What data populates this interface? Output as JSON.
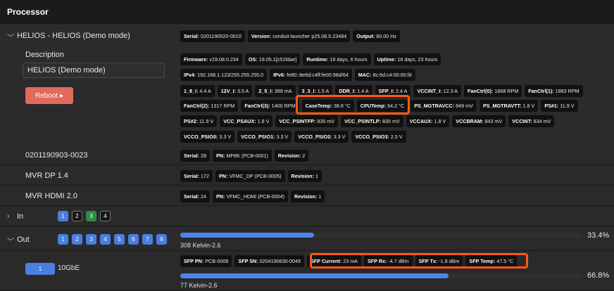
{
  "header": {
    "title": "Processor"
  },
  "helios": {
    "title": "HELIOS - HELIOS (Demo mode)",
    "chips": [
      {
        "k": "Serial:",
        "v": "0201190520-0010"
      },
      {
        "k": "Version:",
        "v": "conduit-launcher p25.08.0.23484"
      },
      {
        "k": "Output:",
        "v": "60.00 Hz"
      }
    ],
    "description_label": "Description",
    "description_value": "HELIOS (Demo mode)",
    "reboot_label": "Reboot ▸",
    "lines": [
      [
        {
          "k": "Firmware:",
          "v": "v19.08.0.234"
        },
        {
          "k": "OS:",
          "v": "19.05.1[c51fdae]"
        },
        {
          "k": "Runtime:",
          "v": "19 days, 6 hours"
        },
        {
          "k": "Uptime:",
          "v": "16 days, 23 hours"
        }
      ],
      [
        {
          "k": "IPv4:",
          "v": "192.168.1.123/255.255.255.0"
        },
        {
          "k": "IPv6:",
          "v": "fe80::8e6d:c4ff:fe00:98d/64"
        },
        {
          "k": "MAC:",
          "v": "8c:6d:c4:00:00:fd"
        }
      ],
      [
        {
          "k": "1_8_I:",
          "v": "4.4 A"
        },
        {
          "k": "12V_I:",
          "v": "3.5 A"
        },
        {
          "k": "2_5_I:",
          "v": "389 mA"
        },
        {
          "k": "3_3_I:",
          "v": "1.5 A"
        },
        {
          "k": "DDR_I:",
          "v": "1.4 A"
        },
        {
          "k": "SFP_I:",
          "v": "2.4 A"
        },
        {
          "k": "VCCINT_I:",
          "v": "12.3 A"
        },
        {
          "k": "FanCtrl(0):",
          "v": "1868 RPM"
        },
        {
          "k": "FanCtrl(1):",
          "v": "1883 RPM"
        }
      ],
      [
        {
          "k": "FanCtrl(2):",
          "v": "1317 RPM"
        },
        {
          "k": "FanCtrl(3):",
          "v": "1400 RPM"
        },
        {
          "k": "CaseTemp:",
          "v": "38.8 °C"
        },
        {
          "k": "CPUTemp:",
          "v": "64.2 °C"
        },
        {
          "k": "PS_MGTRAVCC:",
          "v": "849 mV"
        },
        {
          "k": "PS_MGTRAVTT:",
          "v": "1.8 V"
        },
        {
          "k": "PS#1:",
          "v": "11.9 V"
        }
      ],
      [
        {
          "k": "PS#2:",
          "v": "11.9 V"
        },
        {
          "k": "VCC_PSAUX:",
          "v": "1.8 V"
        },
        {
          "k": "VCC_PSINTFP:",
          "v": "835 mV"
        },
        {
          "k": "VCC_PSINTLP:",
          "v": "835 mV"
        },
        {
          "k": "VCCAUX:",
          "v": "1.8 V"
        },
        {
          "k": "VCCBRAM:",
          "v": "843 mV"
        },
        {
          "k": "VCCINT:",
          "v": "834 mV"
        }
      ],
      [
        {
          "k": "VCCO_PSIO0:",
          "v": "3.3 V"
        },
        {
          "k": "VCCO_PSIO1:",
          "v": "3.3 V"
        },
        {
          "k": "VCCO_PSIO2:",
          "v": "3.3 V"
        },
        {
          "k": "VCCO_PSIO3:",
          "v": "2.5 V"
        }
      ]
    ]
  },
  "boards": [
    {
      "name": "0201190903-0023",
      "chips": [
        {
          "k": "Serial:",
          "v": "28"
        },
        {
          "k": "PN:",
          "v": "MP8K (PCB-0001)"
        },
        {
          "k": "Revision:",
          "v": "2"
        }
      ]
    },
    {
      "name": "MVR DP 1.4",
      "chips": [
        {
          "k": "Serial:",
          "v": "172"
        },
        {
          "k": "PN:",
          "v": "VFMC_DP (PCB-0005)"
        },
        {
          "k": "Revision:",
          "v": "1"
        }
      ]
    },
    {
      "name": "MVR HDMI 2.0",
      "chips": [
        {
          "k": "Serial:",
          "v": "24"
        },
        {
          "k": "PN:",
          "v": "VFMC_HDMI (PCB-0004)"
        },
        {
          "k": "Revision:",
          "v": "1"
        }
      ]
    }
  ],
  "in": {
    "label": "In",
    "ports": [
      "1",
      "2",
      "3",
      "4"
    ]
  },
  "out": {
    "label": "Out",
    "ports": [
      "1",
      "2",
      "3",
      "4",
      "5",
      "6",
      "7",
      "8"
    ],
    "progress_pct": 33.4,
    "progress_label": "33.4%",
    "kelvin": "308 Kelvin-2.6"
  },
  "sfp": {
    "port": "1",
    "name": "10GbE",
    "chips": [
      {
        "k": "SFP PN:",
        "v": "PCB-0008"
      },
      {
        "k": "SFP SN:",
        "v": "0204190630-0049"
      },
      {
        "k": "SFP Current:",
        "v": "23 mA"
      },
      {
        "k": "SFP Rx:",
        "v": "-4.7 dBm"
      },
      {
        "k": "SFP Tx:",
        "v": "-1.8 dBm"
      },
      {
        "k": "SFP Temp:",
        "v": "47.5 °C"
      }
    ],
    "progress_pct": 66.8,
    "progress_label": "66.8%",
    "kelvin": "77 Kelvin-2.6"
  },
  "icons": {
    "expand": "chevron-down-icon",
    "collapsed": "chevron-right-icon"
  },
  "colors": {
    "accent": "#4a86e8",
    "highlight": "#ff5a12",
    "reboot": "#e06a5c",
    "green_port": "#2d8c4a"
  }
}
